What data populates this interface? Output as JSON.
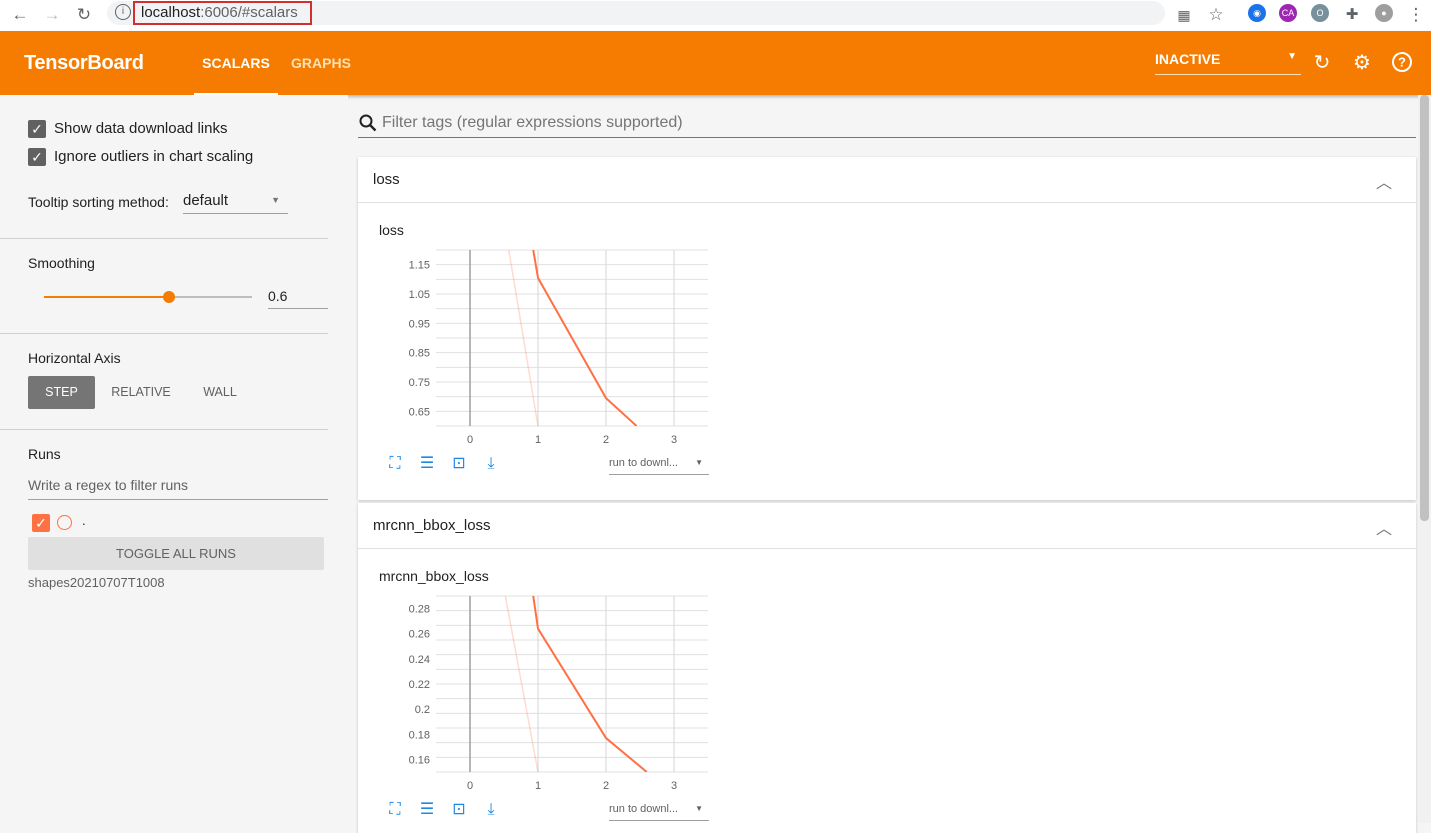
{
  "browser": {
    "url_host": "localhost",
    "url_rest": ":6006/#scalars",
    "ext_ca": "CA"
  },
  "header": {
    "brand": "TensorBoard",
    "tabs": [
      {
        "label": "SCALARS",
        "active": true
      },
      {
        "label": "GRAPHS",
        "active": false
      }
    ],
    "status": "INACTIVE"
  },
  "sidebar": {
    "show_download_links": "Show data download links",
    "ignore_outliers": "Ignore outliers in chart scaling",
    "tooltip_label": "Tooltip sorting method:",
    "tooltip_value": "default",
    "smoothing_title": "Smoothing",
    "smoothing_value": "0.6",
    "smoothing_fraction": 0.6,
    "axis_title": "Horizontal Axis",
    "axis_options": [
      "STEP",
      "RELATIVE",
      "WALL"
    ],
    "runs_title": "Runs",
    "runs_filter_placeholder": "Write a regex to filter runs",
    "run_dot_label": ".",
    "toggle_all": "TOGGLE ALL RUNS",
    "run_name": "shapes20210707T1008"
  },
  "main": {
    "filter_placeholder": "Filter tags (regular expressions supported)",
    "download_select": "run to downl...",
    "accent": "#f57c00",
    "series_color": "#ff7043"
  },
  "chart_data": [
    {
      "type": "line",
      "card": "loss",
      "title": "loss",
      "x_ticks": [
        "0",
        "1",
        "2",
        "3"
      ],
      "y_ticks": [
        "1.15",
        "1.05",
        "0.95",
        "0.85",
        "0.75",
        "0.65"
      ],
      "xlim": [
        -0.5,
        3.5
      ],
      "ylim": [
        0.6,
        1.2
      ],
      "series": [
        {
          "role": "smoothed",
          "x": [
            0.93,
            1.0,
            2.0,
            2.45
          ],
          "y": [
            1.2,
            1.105,
            0.695,
            0.6
          ]
        },
        {
          "role": "raw",
          "x": [
            0.57,
            1.0
          ],
          "y": [
            1.2,
            0.6
          ]
        }
      ]
    },
    {
      "type": "line",
      "card": "mrcnn_bbox_loss",
      "title": "mrcnn_bbox_loss",
      "x_ticks": [
        "0",
        "1",
        "2",
        "3"
      ],
      "y_ticks": [
        "0.28",
        "0.26",
        "0.24",
        "0.22",
        "0.2",
        "0.18",
        "0.16"
      ],
      "xlim": [
        -0.5,
        3.5
      ],
      "ylim": [
        0.15,
        0.29
      ],
      "series": [
        {
          "role": "smoothed",
          "x": [
            0.93,
            1.0,
            2.0,
            2.6
          ],
          "y": [
            0.29,
            0.264,
            0.177,
            0.15
          ]
        },
        {
          "role": "raw",
          "x": [
            0.52,
            1.0
          ],
          "y": [
            0.29,
            0.15
          ]
        }
      ]
    }
  ]
}
